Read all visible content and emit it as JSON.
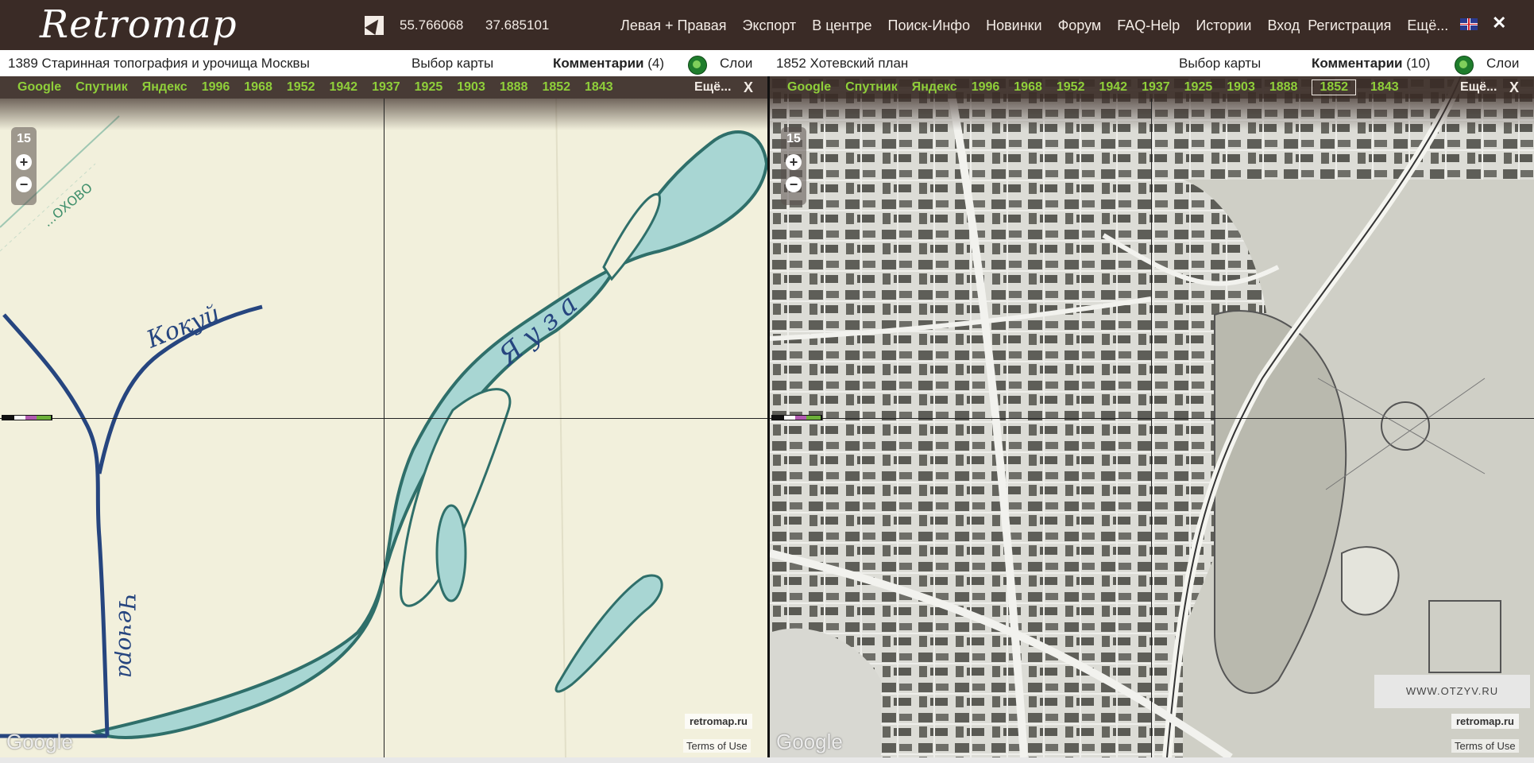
{
  "header": {
    "logo_text": "Retromap",
    "latitude": "55.766068",
    "longitude": "37.685101",
    "menu": [
      "Левая + Правая",
      "Экспорт",
      "В центре",
      "Поиск-Инфо",
      "Новинки",
      "Форум",
      "FAQ-Help",
      "Истории",
      "Вход",
      "Регистрация",
      "Ещё..."
    ],
    "close_label": "✕",
    "colors": {
      "header_bg": "#3a2b26",
      "link_green": "#8fcf3a"
    }
  },
  "left_panel": {
    "map_title": "1389 Старинная топография и урочища Москвы",
    "select_map": "Выбор карты",
    "comments_label": "Комментарии",
    "comments_count": "(4)",
    "layers_label": "Слои",
    "map_types": [
      "Google",
      "Спутник",
      "Яндекс",
      "1996",
      "1968",
      "1952",
      "1942",
      "1937",
      "1925",
      "1903",
      "1888",
      "1852",
      "1843"
    ],
    "more_label": "Ещё...",
    "close_label": "X",
    "zoom_level": "15",
    "zoom_in": "+",
    "zoom_out": "−",
    "map_labels": {
      "river1": "Кокуй",
      "river2": "Яуза",
      "river3": "Чечора",
      "corner": "...ОХОВО"
    },
    "credit": "retromap.ru",
    "terms": "Terms of Use",
    "google": "Google"
  },
  "right_panel": {
    "map_title": "1852 Хотевский план",
    "select_map": "Выбор карты",
    "comments_label": "Комментарии",
    "comments_count": "(10)",
    "layers_label": "Слои",
    "map_types": [
      "Google",
      "Спутник",
      "Яндекс",
      "1996",
      "1968",
      "1952",
      "1942",
      "1937",
      "1925",
      "1903",
      "1888",
      "1852",
      "1843"
    ],
    "active_map_type": "1852",
    "more_label": "Ещё...",
    "close_label": "X",
    "zoom_level": "15",
    "zoom_in": "+",
    "zoom_out": "−",
    "credit": "retromap.ru",
    "terms": "Terms of Use",
    "google": "Google"
  },
  "watermark": "WWW.OTZYV.RU"
}
